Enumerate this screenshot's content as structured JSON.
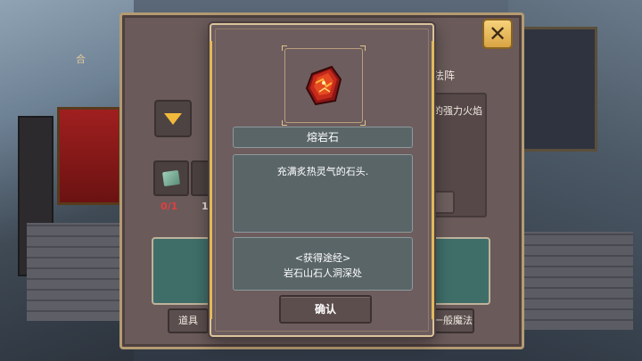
{
  "background_panel": {
    "title": "合成法阵",
    "left_header": "合",
    "right_header": "法阵",
    "right_description": "的强力火焰",
    "material_counts": [
      "0/1",
      "1"
    ],
    "tab_left_label": "道具",
    "tab_right_label": "一般魔法"
  },
  "item_popup": {
    "item_icon": "lava-stone-icon",
    "item_name": "熔岩石",
    "description": "充满炙热灵气的石头.",
    "source_title": "<获得途经>",
    "source_text": "岩石山石人洞深处",
    "confirm_label": "确认"
  },
  "close_button": {
    "icon": "close-icon",
    "symbol": "✕"
  },
  "colors": {
    "panel_bg": "#6d5d5e",
    "panel_border": "#d9c39c",
    "info_box_bg": "#5a6568",
    "close_btn_gold": "#f2c45e",
    "count_missing_red": "#e04040",
    "dropdown_arrow": "#f2b93a"
  }
}
